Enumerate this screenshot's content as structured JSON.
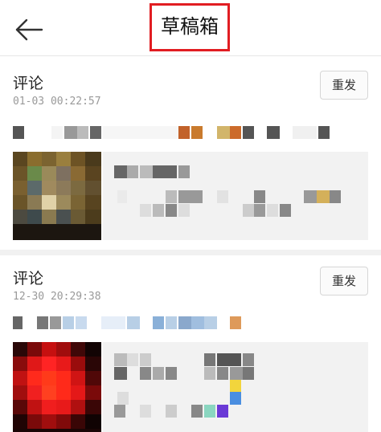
{
  "header": {
    "title": "草稿箱",
    "back_icon": "back-arrow-icon"
  },
  "drafts": [
    {
      "type_label": "评论",
      "timestamp": "01-03 00:22:57",
      "resend_label": "重发"
    },
    {
      "type_label": "评论",
      "timestamp": "12-30 20:29:38",
      "resend_label": "重发"
    }
  ],
  "colors": {
    "highlight_border": "#e11d22",
    "separator": "#f1f1f1",
    "quote_background": "#f2f2f2"
  }
}
